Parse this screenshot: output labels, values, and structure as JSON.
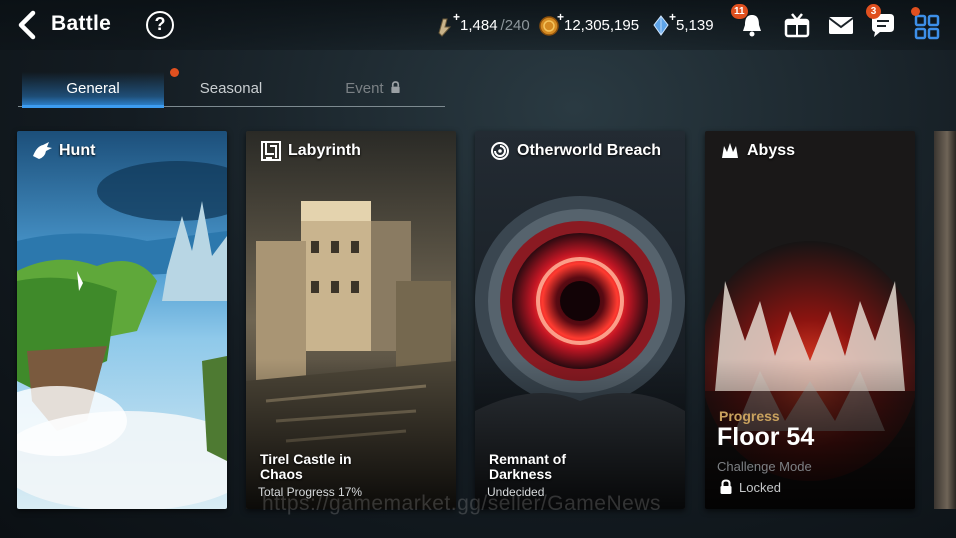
{
  "header": {
    "title": "Battle",
    "help_glyph": "?"
  },
  "resources": {
    "stamina": {
      "icon": "stamina-icon",
      "value": "1,484",
      "max": "/240"
    },
    "gold": {
      "icon": "gold-coin-icon",
      "value": "12,305,195"
    },
    "crystal": {
      "icon": "crystal-icon",
      "value": "5,139"
    }
  },
  "nav": {
    "notifications_badge": "11",
    "chat_badge": "3"
  },
  "tabs": [
    {
      "label": "General",
      "state": "active"
    },
    {
      "label": "Seasonal",
      "state": "new"
    },
    {
      "label": "Event",
      "state": "locked"
    }
  ],
  "cards": {
    "hunt": {
      "title": "Hunt"
    },
    "labyrinth": {
      "title": "Labyrinth",
      "subtitle_line1": "Tirel Castle in",
      "subtitle_line2": "Chaos",
      "info": "Total Progress 17%"
    },
    "breach": {
      "title": "Otherworld Breach",
      "subtitle_line1": "Remnant of",
      "subtitle_line2": "Darkness",
      "info": "Undecided"
    },
    "abyss": {
      "title": "Abyss",
      "progress_label": "Progress",
      "floor": "Floor 54",
      "mode": "Challenge Mode",
      "status": "Locked"
    }
  },
  "watermark": "https://gamemarket.gg/seller/GameNews",
  "colors": {
    "accent_blue": "#2e88d8",
    "badge_orange": "#e0501f",
    "progress_gold": "#c9a25e"
  }
}
